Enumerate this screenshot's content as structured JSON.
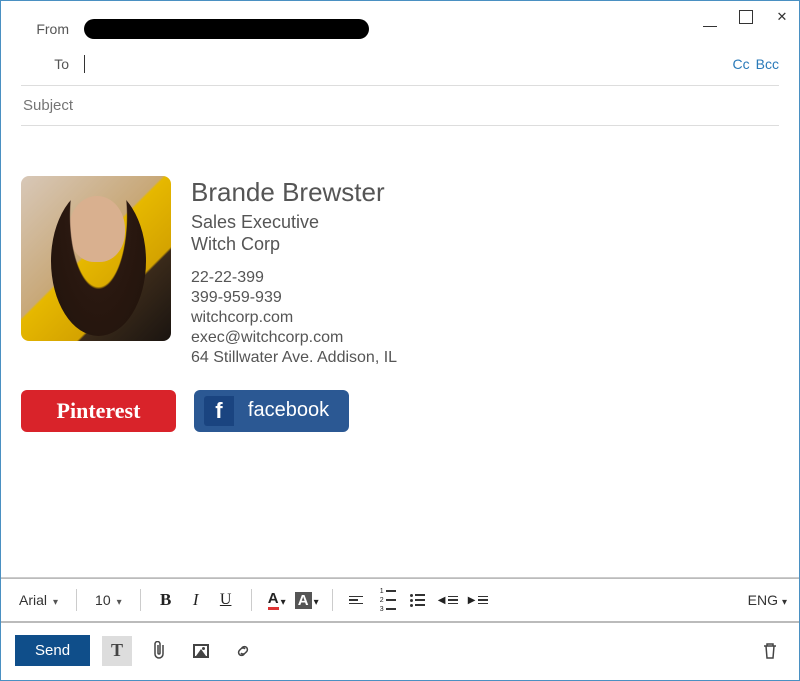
{
  "window": {
    "from_label": "From",
    "to_label": "To",
    "to_value": "",
    "cc_label": "Cc",
    "bcc_label": "Bcc",
    "subject_placeholder": "Subject",
    "subject_value": ""
  },
  "signature": {
    "name": "Brande Brewster",
    "title": "Sales Executive",
    "company": "Witch Corp",
    "phone1": "22-22-399",
    "phone2": "399-959-939",
    "website": "witchcorp.com",
    "email": "exec@witchcorp.com",
    "address": "64 Stillwater Ave. Addison, IL"
  },
  "social": {
    "pinterest_label": "Pinterest",
    "facebook_label": "facebook"
  },
  "toolbar": {
    "font": "Arial",
    "size": "10",
    "lang": "ENG"
  },
  "actions": {
    "send_label": "Send"
  }
}
